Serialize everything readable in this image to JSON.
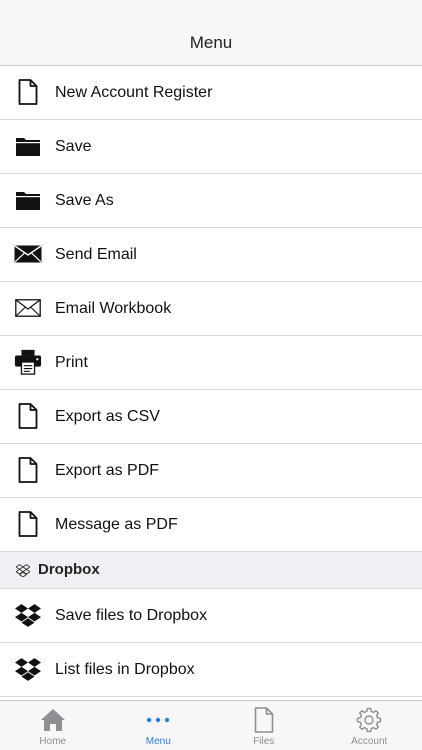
{
  "nav": {
    "title": "Menu"
  },
  "menu_items": [
    {
      "label": "New Account Register",
      "icon": "document-icon"
    },
    {
      "label": "Save",
      "icon": "folder-icon"
    },
    {
      "label": "Save As",
      "icon": "folder-icon"
    },
    {
      "label": "Send Email",
      "icon": "envelope-filled-icon"
    },
    {
      "label": "Email Workbook",
      "icon": "envelope-outline-icon"
    },
    {
      "label": "Print",
      "icon": "printer-icon"
    },
    {
      "label": "Export as CSV",
      "icon": "document-icon"
    },
    {
      "label": "Export as PDF",
      "icon": "document-icon"
    },
    {
      "label": "Message as PDF",
      "icon": "document-icon"
    }
  ],
  "dropbox_section": {
    "title": "Dropbox",
    "icon": "dropbox-outline-icon",
    "items": [
      {
        "label": "Save files to Dropbox",
        "icon": "dropbox-icon"
      },
      {
        "label": "List files in Dropbox",
        "icon": "dropbox-icon"
      }
    ]
  },
  "tabbar": {
    "tabs": [
      {
        "label": "Home",
        "icon": "home-icon",
        "active": false
      },
      {
        "label": "Menu",
        "icon": "more-icon",
        "active": true
      },
      {
        "label": "Files",
        "icon": "file-icon",
        "active": false
      },
      {
        "label": "Account",
        "icon": "gear-icon",
        "active": false
      }
    ],
    "accent_color": "#2f7be6",
    "inactive_color": "#8e8e93"
  }
}
